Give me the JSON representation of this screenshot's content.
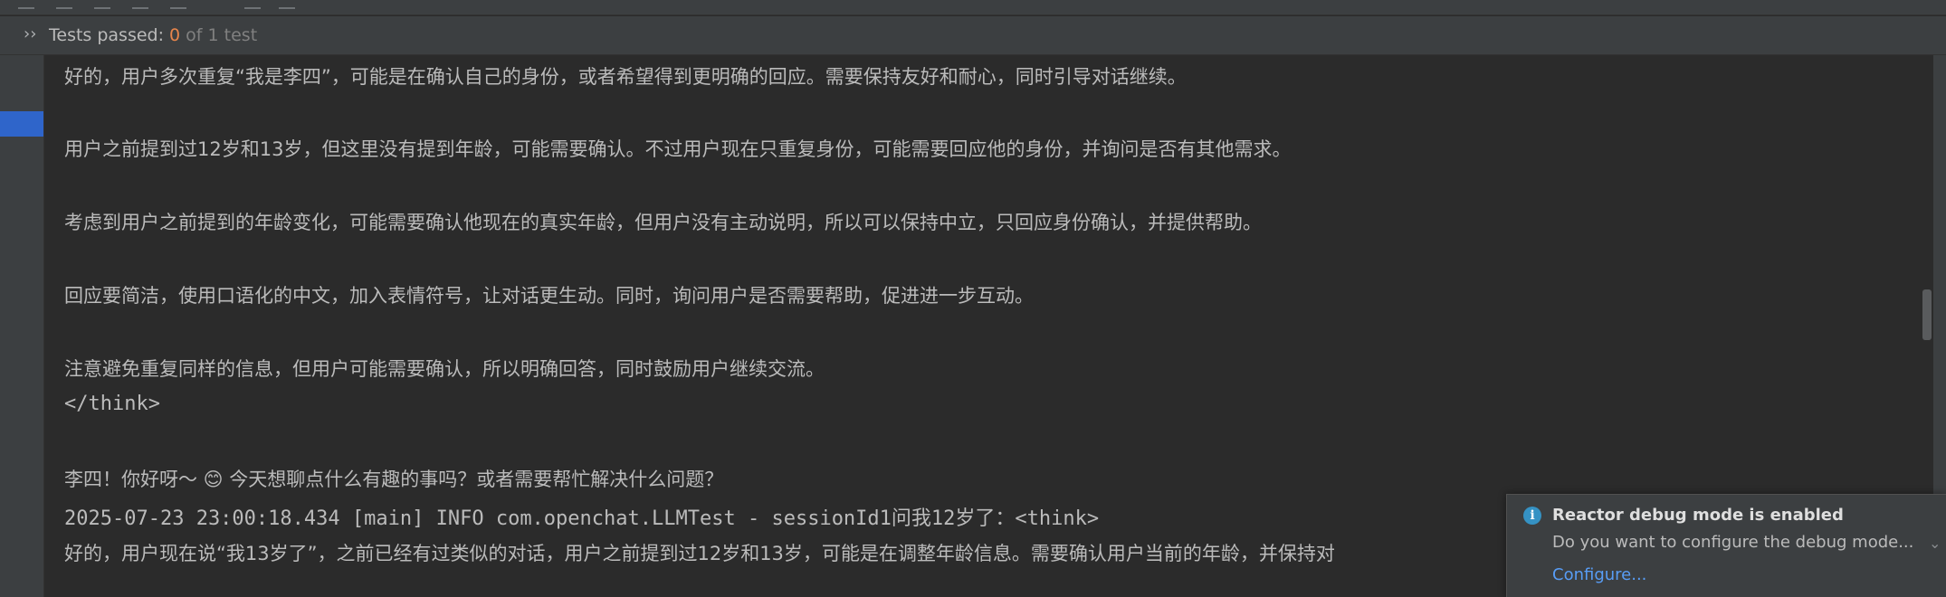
{
  "status": {
    "label": "Tests passed: ",
    "count": "0",
    "total": " of 1 test"
  },
  "console": {
    "lines": [
      "好的，用户多次重复“我是李四”，可能是在确认自己的身份，或者希望得到更明确的回应。需要保持友好和耐心，同时引导对话继续。",
      "用户之前提到过12岁和13岁，但这里没有提到年龄，可能需要确认。不过用户现在只重复身份，可能需要回应他的身份，并询问是否有其他需求。",
      "考虑到用户之前提到的年龄变化，可能需要确认他现在的真实年龄，但用户没有主动说明，所以可以保持中立，只回应身份确认，并提供帮助。",
      "回应要简洁，使用口语化的中文，加入表情符号，让对话更生动。同时，询问用户是否需要帮助，促进进一步互动。",
      "注意避免重复同样的信息，但用户可能需要确认，所以明确回答，同时鼓励用户继续交流。",
      "</think>",
      "李四！你好呀～ 😊 今天想聊点什么有趣的事吗？或者需要帮忙解决什么问题？",
      "2025-07-23 23:00:18.434 [main] INFO  com.openchat.LLMTest - sessionId1问我12岁了：<think>",
      "好的，用户现在说“我13岁了”，之前已经有过类似的对话，用户之前提到过12岁和13岁，可能是在调整年龄信息。需要确认用户当前的年龄，并保持对"
    ]
  },
  "notification": {
    "title": "Reactor debug mode is enabled",
    "body": "Do you want to configure the debug mode...",
    "link": "Configure..."
  },
  "colors": {
    "background": "#2b2b2b",
    "panel": "#3c3f41",
    "text": "#bbbbbb",
    "count_accent": "#e8854b",
    "link": "#589df6",
    "info_icon": "#3592c4",
    "selection": "#2f65ca"
  },
  "icons": {
    "expand": "double-chevron-right-icon",
    "info": "info-icon",
    "notify_toggle": "chevron-down-icon"
  }
}
